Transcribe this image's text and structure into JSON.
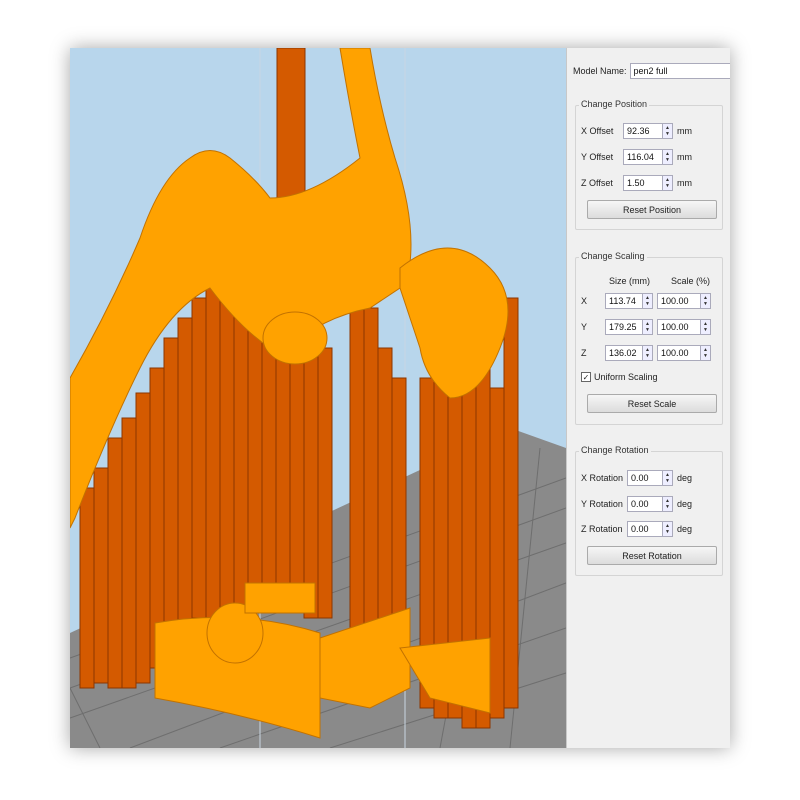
{
  "panel": {
    "model_name_label": "Model Name:",
    "model_name_value": "pen2 full",
    "position": {
      "title": "Change Position",
      "x_label": "X Offset",
      "x_value": "92.36",
      "y_label": "Y Offset",
      "y_value": "116.04",
      "z_label": "Z Offset",
      "z_value": "1.50",
      "unit": "mm",
      "reset_label": "Reset Position"
    },
    "scaling": {
      "title": "Change Scaling",
      "size_header": "Size (mm)",
      "scale_header": "Scale (%)",
      "x_label": "X",
      "x_size": "113.74",
      "x_scale": "100.00",
      "y_label": "Y",
      "y_size": "179.25",
      "y_scale": "100.00",
      "z_label": "Z",
      "z_size": "136.02",
      "z_scale": "100.00",
      "uniform_label": "Uniform Scaling",
      "uniform_checked": true,
      "reset_label": "Reset Scale"
    },
    "rotation": {
      "title": "Change Rotation",
      "x_label": "X Rotation",
      "x_value": "0.00",
      "y_label": "Y Rotation",
      "y_value": "0.00",
      "z_label": "Z Rotation",
      "z_value": "0.00",
      "unit": "deg",
      "reset_label": "Reset Rotation"
    }
  },
  "viewport": {
    "background_color": "#b8d6ec",
    "bed_color": "#8a8a8a",
    "model_color": "#ffa200",
    "support_color": "#d45a00"
  }
}
